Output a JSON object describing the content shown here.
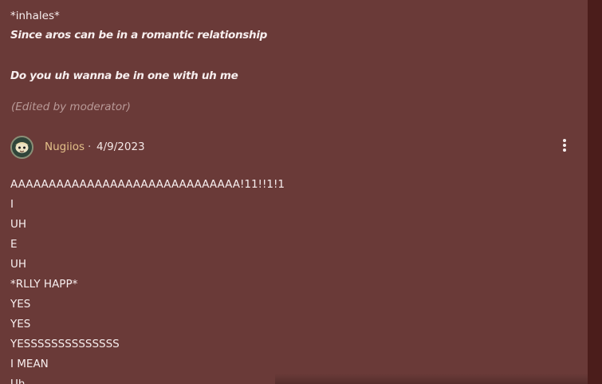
{
  "previous_post": {
    "line1": "*inhales*",
    "line2": "Since aros can be in a romantic relationship",
    "line3": "Do you uh wanna be in one with uh me",
    "edited_note": "(Edited by moderator)"
  },
  "reply": {
    "author": "Nugiios",
    "separator": "·",
    "date": "4/9/2023",
    "body_lines": [
      "AAAAAAAAAAAAAAAAAAAAAAAAAAAAAA!11!!1!1",
      "I",
      "UH",
      "E",
      "UH",
      "*RLLY HAPP*",
      "YES",
      "YES",
      "YESSSSSSSSSSSSSS",
      "I MEAN",
      "Uh"
    ]
  },
  "icons": {
    "avatar": "avatar-icon",
    "more": "kebab-menu-icon"
  },
  "colors": {
    "background": "#6a3a38",
    "author": "#e3c089",
    "text": "#f7eeee",
    "muted": "#b99a98"
  }
}
